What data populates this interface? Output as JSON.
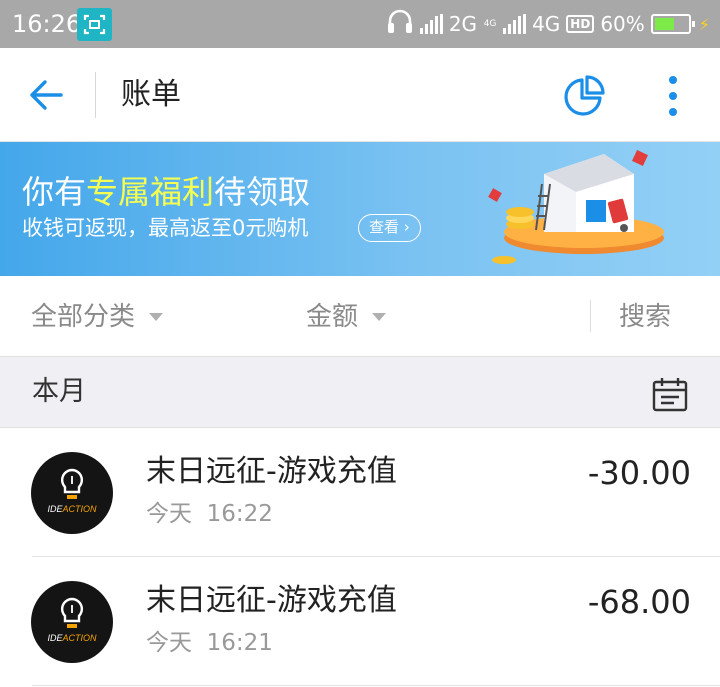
{
  "status_bar": {
    "time": "16:26",
    "network_2g": "2G",
    "network_4g_small": "4G",
    "network_4g": "4G",
    "hd_badge": "HD",
    "battery": "60%",
    "battery_level": 0.6,
    "icons": [
      "screenshot-icon",
      "headphones-icon",
      "signal-icon",
      "hd-icon",
      "battery-icon",
      "charging-icon"
    ]
  },
  "header": {
    "title": "账单",
    "back_icon": "back-arrow-icon",
    "chart_icon": "pie-chart-icon",
    "more_icon": "more-vertical-icon",
    "accent_color": "#1b8ee8"
  },
  "banner": {
    "title_prefix": "你有",
    "title_highlight": "专属福利",
    "title_suffix": "待领取",
    "subtitle": "收钱可返现，最高返至0元购机",
    "button_label": "查看",
    "highlight_color": "#f6ff4f"
  },
  "filters": {
    "category": "全部分类",
    "amount": "金额",
    "search": "搜索"
  },
  "month": {
    "label": "本月",
    "calendar_icon": "calendar-icon"
  },
  "transactions": [
    {
      "title": "末日远征-游戏充值",
      "date": "今天",
      "time": "16:22",
      "amount": "-30.00",
      "avatar_brand_prefix": "IDE",
      "avatar_brand_suffix": "ACTION"
    },
    {
      "title": "末日远征-游戏充值",
      "date": "今天",
      "time": "16:21",
      "amount": "-68.00",
      "avatar_brand_prefix": "IDE",
      "avatar_brand_suffix": "ACTION"
    }
  ]
}
